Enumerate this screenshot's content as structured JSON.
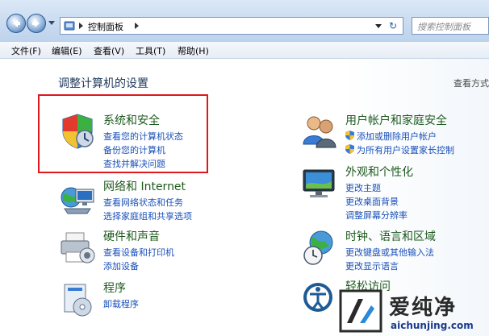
{
  "address_bar": {
    "path_root": "控制面板",
    "search_placeholder": "搜索控制面板"
  },
  "menu": {
    "items": [
      "文件(F)",
      "编辑(E)",
      "查看(V)",
      "工具(T)",
      "帮助(H)"
    ]
  },
  "main": {
    "title": "调整计算机的设置",
    "view_by": "查看方式"
  },
  "categories": {
    "system_security": {
      "title": "系统和安全",
      "links": [
        "查看您的计算机状态",
        "备份您的计算机",
        "查找并解决问题"
      ]
    },
    "network": {
      "title": "网络和 Internet",
      "links": [
        "查看网络状态和任务",
        "选择家庭组和共享选项"
      ]
    },
    "hardware": {
      "title": "硬件和声音",
      "links": [
        "查看设备和打印机",
        "添加设备"
      ]
    },
    "programs": {
      "title": "程序",
      "links": [
        "卸载程序"
      ]
    },
    "user_accounts": {
      "title": "用户帐户和家庭安全",
      "links": [
        "添加或删除用户帐户",
        "为所有用户设置家长控制"
      ]
    },
    "appearance": {
      "title": "外观和个性化",
      "links": [
        "更改主题",
        "更改桌面背景",
        "调整屏幕分辨率"
      ]
    },
    "clock": {
      "title": "时钟、语言和区域",
      "links": [
        "更改键盘或其他输入法",
        "更改显示语言"
      ]
    },
    "ease": {
      "title": "轻松访问"
    }
  },
  "watermark": {
    "brand": "爱纯净",
    "url": "aichunjing.com"
  },
  "colors": {
    "highlight_border": "#e0171c",
    "link": "#1a50b8",
    "category_title": "#1e5a1e"
  }
}
